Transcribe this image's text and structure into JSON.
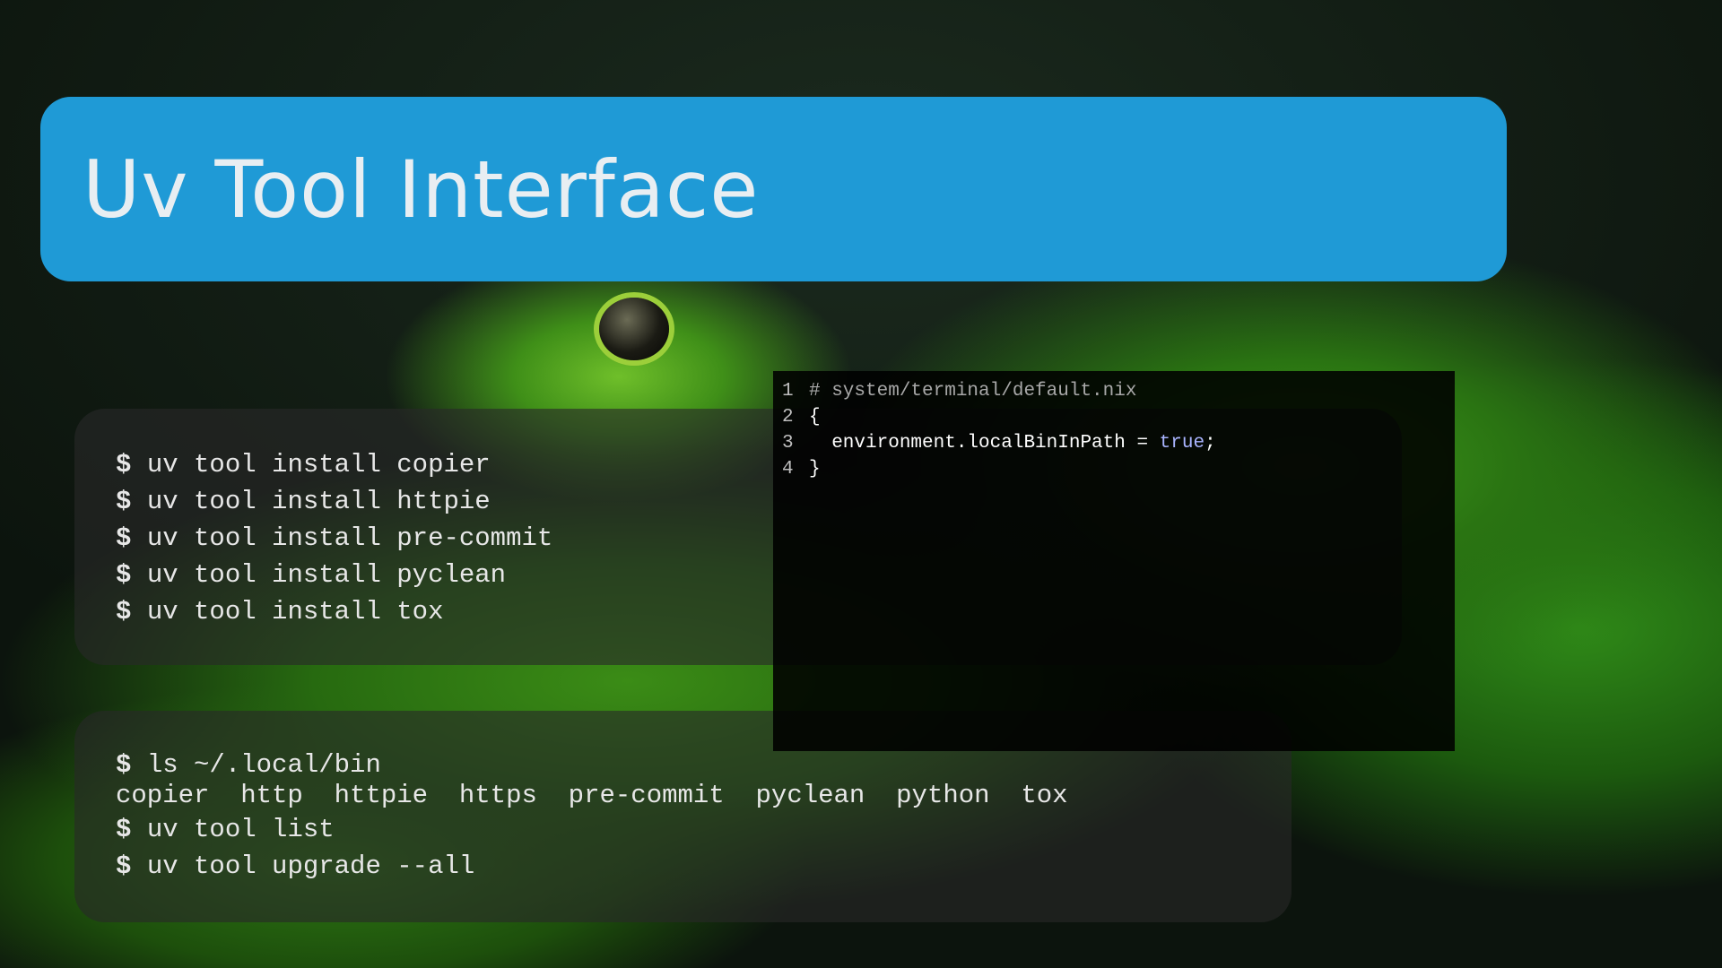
{
  "slide": {
    "title": "Uv Tool Interface"
  },
  "install_block": {
    "lines": [
      {
        "prompt": "$",
        "command": "uv tool install copier"
      },
      {
        "prompt": "$",
        "command": "uv tool install httpie"
      },
      {
        "prompt": "$",
        "command": "uv tool install pre-commit"
      },
      {
        "prompt": "$",
        "command": "uv tool install pyclean"
      },
      {
        "prompt": "$",
        "command": "uv tool install tox"
      }
    ]
  },
  "ls_block": {
    "line1": {
      "prompt": "$",
      "command": "ls ~/.local/bin"
    },
    "output": "copier  http  httpie  https  pre-commit  pyclean  python  tox",
    "line3": {
      "prompt": "$",
      "command": "uv tool list"
    },
    "line4": {
      "prompt": "$",
      "command": "uv tool upgrade --all"
    }
  },
  "code_block": {
    "rows": [
      {
        "num": "1",
        "text": "# system/terminal/default.nix"
      },
      {
        "num": "2",
        "text": "{"
      },
      {
        "num": "3",
        "text": "  environment.localBinInPath = ",
        "keyword": "true",
        "after": ";"
      },
      {
        "num": "4",
        "text": "}"
      }
    ]
  },
  "colors": {
    "header_bg": "#1f9ad6",
    "keyword": "#a9b4ff"
  }
}
